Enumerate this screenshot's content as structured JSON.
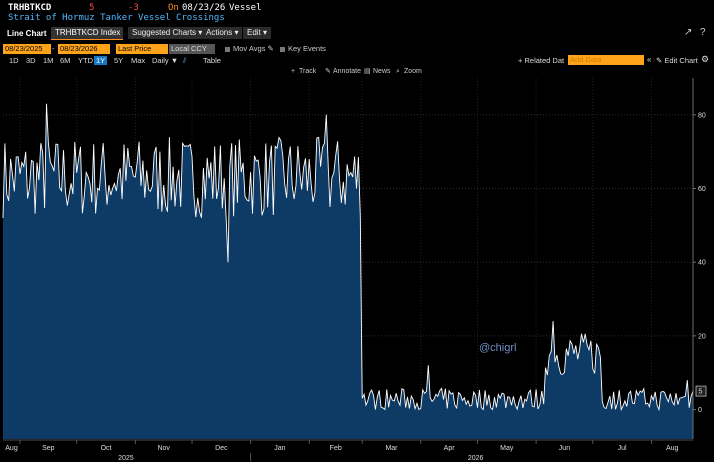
{
  "header": {
    "ticker": "TRHBTKCD",
    "last_value": "5",
    "change": "-3",
    "on_label": "On",
    "date": "08/23/26",
    "unit_label": "Vessel",
    "description": "Strait of Hormuz Tanker Vessel Crossings"
  },
  "toolbar": {
    "chart_type": "Line Chart",
    "security": "TRHBTKCD Index",
    "suggested_charts": "Suggested Charts",
    "actions": "Actions",
    "edit": "Edit",
    "start_date": "08/23/2025",
    "end_date": "08/23/2026",
    "field": "Last Price",
    "currency": "Local CCY",
    "mov_avgs": "Mov Avgs",
    "key_events": "Key Events",
    "ranges": [
      "1D",
      "3D",
      "1M",
      "6M",
      "YTD",
      "1Y",
      "5Y",
      "Max"
    ],
    "frequency": "Daily",
    "table": "Table",
    "related_data": "Related Dat",
    "add_data_placeholder": "Add Data",
    "edit_chart": "Edit Chart"
  },
  "chart_tools": [
    "Track",
    "Annotate",
    "News",
    "Zoom"
  ],
  "watermark": "@chigrl",
  "icons": {
    "export": "export-icon",
    "help": "help-icon",
    "settings": "gear-icon",
    "pencil": "pencil-icon",
    "collapse": "collapse-icon"
  },
  "colors": {
    "line": "#ffffff",
    "fill": "#0e3b66",
    "accent": "#ffa31a",
    "ticker_change": "#ff4d4d",
    "description": "#4fb7ff"
  },
  "chart_data": {
    "type": "area",
    "title": "",
    "ylim": [
      -8,
      90
    ],
    "yticks": [
      0,
      20,
      40,
      60,
      80
    ],
    "x_months": [
      "Aug",
      "Sep",
      "Oct",
      "Nov",
      "Dec",
      "Jan",
      "Feb",
      "Mar",
      "Apr",
      "May",
      "Jun",
      "Jul",
      "Aug"
    ],
    "x_years": [
      "2025",
      "2026"
    ],
    "last_value_marker": "5",
    "series": [
      {
        "name": "",
        "segments": [
          {
            "from": "2025-08-23",
            "to": "2026-02-28",
            "mean": 63,
            "amplitude": 11
          },
          {
            "from": "2026-03-01",
            "to": "2026-06-05",
            "mean": 2.5,
            "amplitude": 3
          },
          {
            "from": "2026-06-06",
            "to": "2026-07-05",
            "mean": 15,
            "amplitude": 6
          },
          {
            "from": "2026-07-06",
            "to": "2026-08-23",
            "mean": 2.5,
            "amplitude": 3
          }
        ],
        "peaks": [
          {
            "date": "2025-09-15",
            "value": 83
          },
          {
            "date": "2026-02-10",
            "value": 80
          },
          {
            "date": "2025-12-20",
            "value": 40
          },
          {
            "date": "2026-06-10",
            "value": 24
          },
          {
            "date": "2026-04-05",
            "value": 12
          },
          {
            "date": "2026-08-20",
            "value": 8
          }
        ]
      }
    ]
  }
}
